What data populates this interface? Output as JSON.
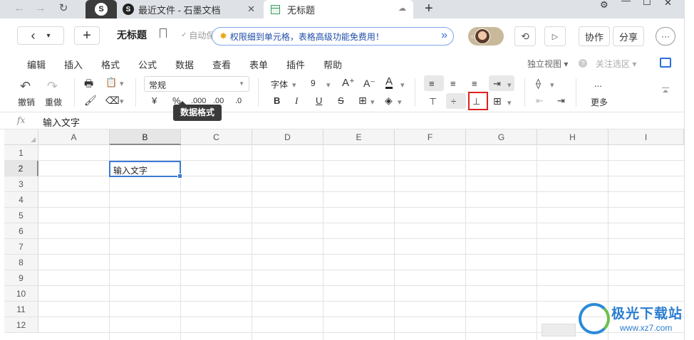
{
  "browser": {
    "tabs": [
      {
        "label": ""
      },
      {
        "label": "最近文件 - 石墨文档"
      },
      {
        "label": "无标题"
      }
    ],
    "new_tab": "+",
    "window_controls": [
      "⚙",
      "—",
      "☐",
      "✕"
    ]
  },
  "docbar": {
    "back": "‹",
    "dropdown": "▾",
    "new": "+",
    "title": "无标题",
    "save_status": "自动保存成功",
    "promo": "权限细到单元格，表格高级功能免费用！",
    "promo_more": "»",
    "collaborate": "协作",
    "share": "分享",
    "more": "···"
  },
  "menu": {
    "items": [
      "编辑",
      "插入",
      "格式",
      "公式",
      "数据",
      "查看",
      "表单",
      "插件",
      "帮助"
    ],
    "view_mode": "独立视图 ▾",
    "focus_select": "关注选区 ▾"
  },
  "toolbar": {
    "undo": "撤销",
    "redo": "重做",
    "number_format": "常规",
    "currency": "¥",
    "percent": "%",
    "thousands": ".000",
    "dec_inc": ".00",
    "dec_dec": ".0",
    "font": "字体",
    "font_size": "9",
    "font_grow": "A⁺",
    "font_shrink": "A⁻",
    "font_color": "A",
    "bold": "B",
    "italic": "I",
    "underline": "U",
    "strike": "S",
    "more": "更多",
    "more_dots": "...",
    "tooltip": "数据格式"
  },
  "formula": {
    "fx": "fx",
    "value": "输入文字"
  },
  "sheet": {
    "columns": [
      "A",
      "B",
      "C",
      "D",
      "E",
      "F",
      "G",
      "H",
      "I"
    ],
    "rows": [
      "1",
      "2",
      "3",
      "4",
      "5",
      "6",
      "7",
      "8",
      "9",
      "10",
      "11",
      "12"
    ],
    "active_cell_value": "输入文字"
  },
  "watermark": {
    "title": "极光下载站",
    "url": "www.xz7.com"
  }
}
